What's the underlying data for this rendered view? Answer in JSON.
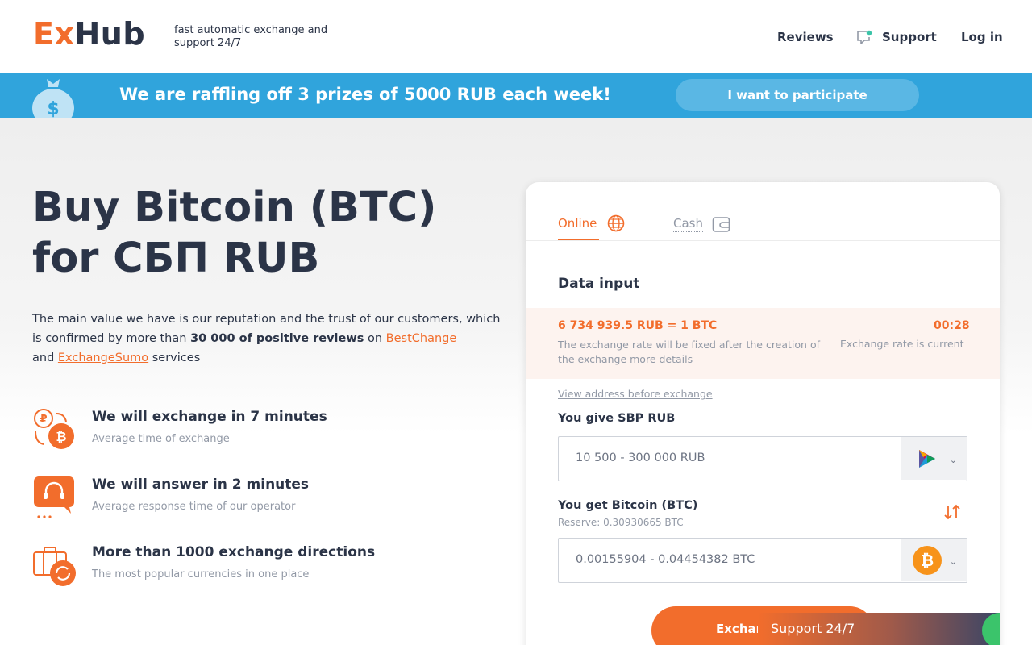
{
  "header": {
    "logo_ex": "Ex",
    "logo_hub": "Hub",
    "tagline": "fast automatic exchange and support 24/7",
    "nav": {
      "reviews": "Reviews",
      "support": "Support",
      "login": "Log in"
    }
  },
  "banner": {
    "text": "We are raffling off 3 prizes of 5000 RUB each week!",
    "button": "I want to participate"
  },
  "hero": {
    "title_line1": "Buy Bitcoin (BTC)",
    "title_line2": "for СБП RUB",
    "desc_1": "The main value we have is our reputation and the trust of our customers, which is confirmed by more than ",
    "desc_bold": "30 000 of positive reviews",
    "desc_2": " on ",
    "link_bestchange": "BestChange",
    "desc_3": " and ",
    "link_exchangesumo": "ExchangeSumo",
    "desc_4": " services"
  },
  "features": [
    {
      "title": "We will exchange in 7 minutes",
      "subtitle": "Average time of exchange",
      "icon": "exchange-rub-btc-icon"
    },
    {
      "title": "We will answer in 2 minutes",
      "subtitle": "Average response time of our operator",
      "icon": "operator-chat-icon"
    },
    {
      "title": "More than 1000 exchange directions",
      "subtitle": "The most popular currencies in one place",
      "icon": "briefcase-refresh-icon"
    }
  ],
  "exchange_card": {
    "tabs": {
      "online": "Online",
      "cash": "Cash"
    },
    "title": "Data input",
    "rate": {
      "value": "6 734 939.5 RUB = 1 BTC",
      "timer": "00:28",
      "note": "The exchange rate will be fixed after the creation of the exchange ",
      "note_link": "more details",
      "status": "Exchange rate is current"
    },
    "view_address": "View address before exchange",
    "give": {
      "label": "You give SBP RUB",
      "placeholder": "10 500 - 300 000 RUB",
      "currency_icon": "sbp-icon"
    },
    "get": {
      "label": "You get Bitcoin (BTC)",
      "reserve": "Reserve: 0.30930665 BTC",
      "placeholder": "0.00155904 - 0.04454382 BTC",
      "currency_icon": "bitcoin-icon"
    },
    "exchange_button": "Exchan"
  },
  "support_widget": {
    "label": "Support 24/7"
  },
  "colors": {
    "accent": "#f26d2c",
    "banner": "#30a4dc",
    "text": "#2b3447",
    "muted": "#9299a6"
  }
}
